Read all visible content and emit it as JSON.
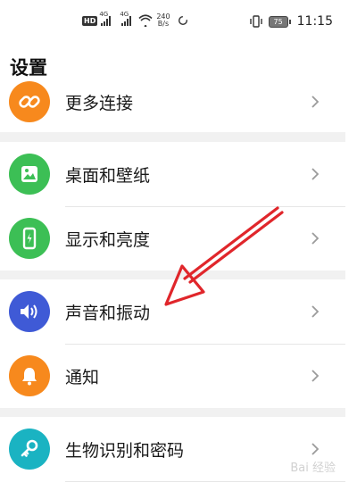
{
  "status_bar": {
    "hd_badge": "HD",
    "net_1": "4G",
    "net_2": "4G",
    "speed_value": "240",
    "speed_unit": "B/s",
    "battery": "75",
    "time": "11:15"
  },
  "page": {
    "title": "设置"
  },
  "settings_items": [
    {
      "label": "更多连接",
      "icon": "link-icon",
      "color": "#f7891d"
    },
    {
      "label": "桌面和壁纸",
      "icon": "image-icon",
      "color": "#3cbf55"
    },
    {
      "label": "显示和亮度",
      "icon": "phone-brightness-icon",
      "color": "#3cbf55"
    },
    {
      "label": "声音和振动",
      "icon": "speaker-icon",
      "color": "#3f5ad6"
    },
    {
      "label": "通知",
      "icon": "bell-icon",
      "color": "#f7891d"
    },
    {
      "label": "生物识别和密码",
      "icon": "key-icon",
      "color": "#1ab3c2"
    }
  ],
  "watermark": {
    "text": "Bai 经验"
  },
  "annotation": {
    "arrow_color": "#e0262b"
  }
}
